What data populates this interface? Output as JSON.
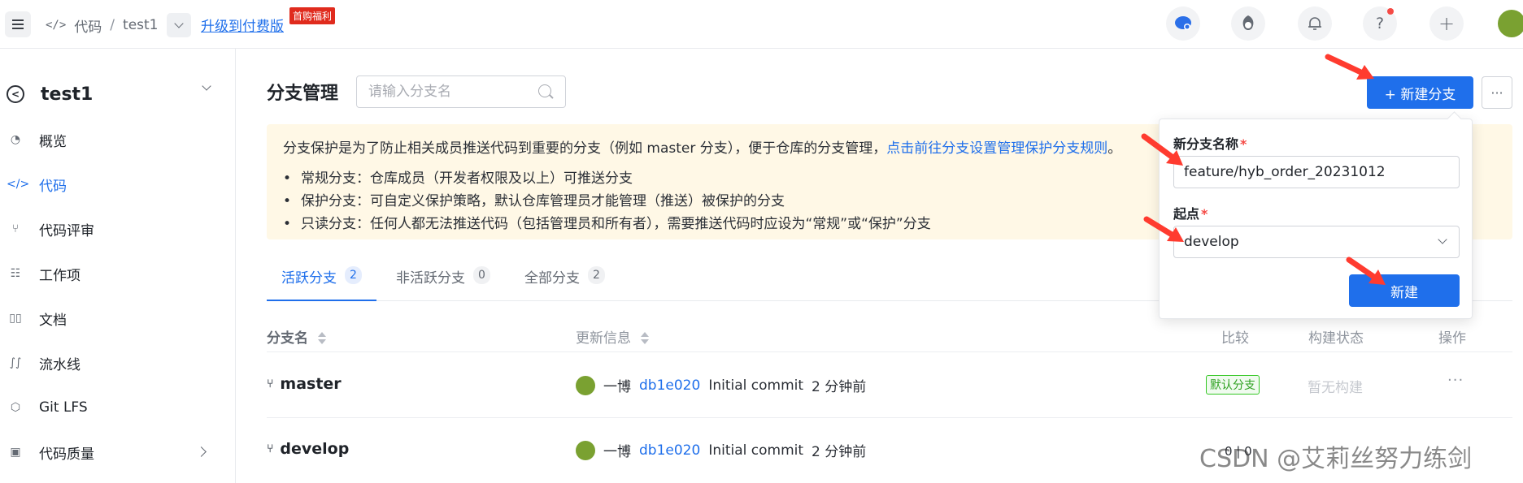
{
  "topbar": {
    "breadcrumb_code_icon": "</>",
    "breadcrumb_code": "代码",
    "breadcrumb_sep": "/",
    "breadcrumb_repo": "test1",
    "upgrade_link": "升级到付费版",
    "promo_badge": "首购福利",
    "icons": [
      "assistant-icon",
      "community-icon",
      "bell-icon",
      "help-icon",
      "plus-icon",
      "avatar"
    ]
  },
  "sidebar": {
    "repo_name": "test1",
    "items": [
      {
        "label": "概览",
        "icon": "gauge-icon"
      },
      {
        "label": "代码",
        "icon": "code-icon"
      },
      {
        "label": "代码评审",
        "icon": "merge-icon"
      },
      {
        "label": "工作项",
        "icon": "task-icon"
      },
      {
        "label": "文档",
        "icon": "book-icon"
      },
      {
        "label": "流水线",
        "icon": "pipeline-icon"
      },
      {
        "label": "Git LFS",
        "icon": "box-icon"
      },
      {
        "label": "代码质量",
        "icon": "quality-icon"
      }
    ]
  },
  "main": {
    "title": "分支管理",
    "search_placeholder": "请输入分支名",
    "notice": {
      "text": "分支保护是为了防止相关成员推送代码到重要的分支（例如 master 分支），便于仓库的分支管理，",
      "link": "点击前往分支设置管理保护分支规则",
      "end": "。",
      "items": [
        "常规分支：仓库成员（开发者权限及以上）可推送分支",
        "保护分支：可自定义保护策略，默认仓库管理员才能管理（推送）被保护的分支",
        "只读分支：任何人都无法推送代码（包括管理员和所有者），需要推送代码时应设为“常规”或“保护”分支"
      ]
    },
    "tabs": [
      {
        "label": "活跃分支",
        "count": "2"
      },
      {
        "label": "非活跃分支",
        "count": "0"
      },
      {
        "label": "全部分支",
        "count": "2"
      }
    ],
    "table": {
      "headers": {
        "name": "分支名",
        "update": "更新信息",
        "compare": "比较",
        "build": "构建状态",
        "action": "操作"
      },
      "rows": [
        {
          "name": "master",
          "author": "一博",
          "hash": "db1e020",
          "message": "Initial commit",
          "time": "2 分钟前",
          "badge": "默认分支",
          "build": "暂无构建",
          "more": "···"
        },
        {
          "name": "develop",
          "author": "一博",
          "hash": "db1e020",
          "message": "Initial commit",
          "time": "2 分钟前",
          "compare": "0 | 0"
        }
      ]
    },
    "new_branch_button": "+ 新建分支",
    "more_button": "···"
  },
  "popover": {
    "name_label": "新分支名称",
    "name_value": "feature/hyb_order_20231012",
    "origin_label": "起点",
    "origin_value": "develop",
    "create_button": "新建",
    "required_mark": "*"
  },
  "watermark": "CSDN @艾莉丝努力练剑",
  "colors": {
    "primary": "#1f6feb",
    "promo": "#e02b1d",
    "notice_bg": "#fff8e6",
    "arrow": "#ff3b2f"
  }
}
